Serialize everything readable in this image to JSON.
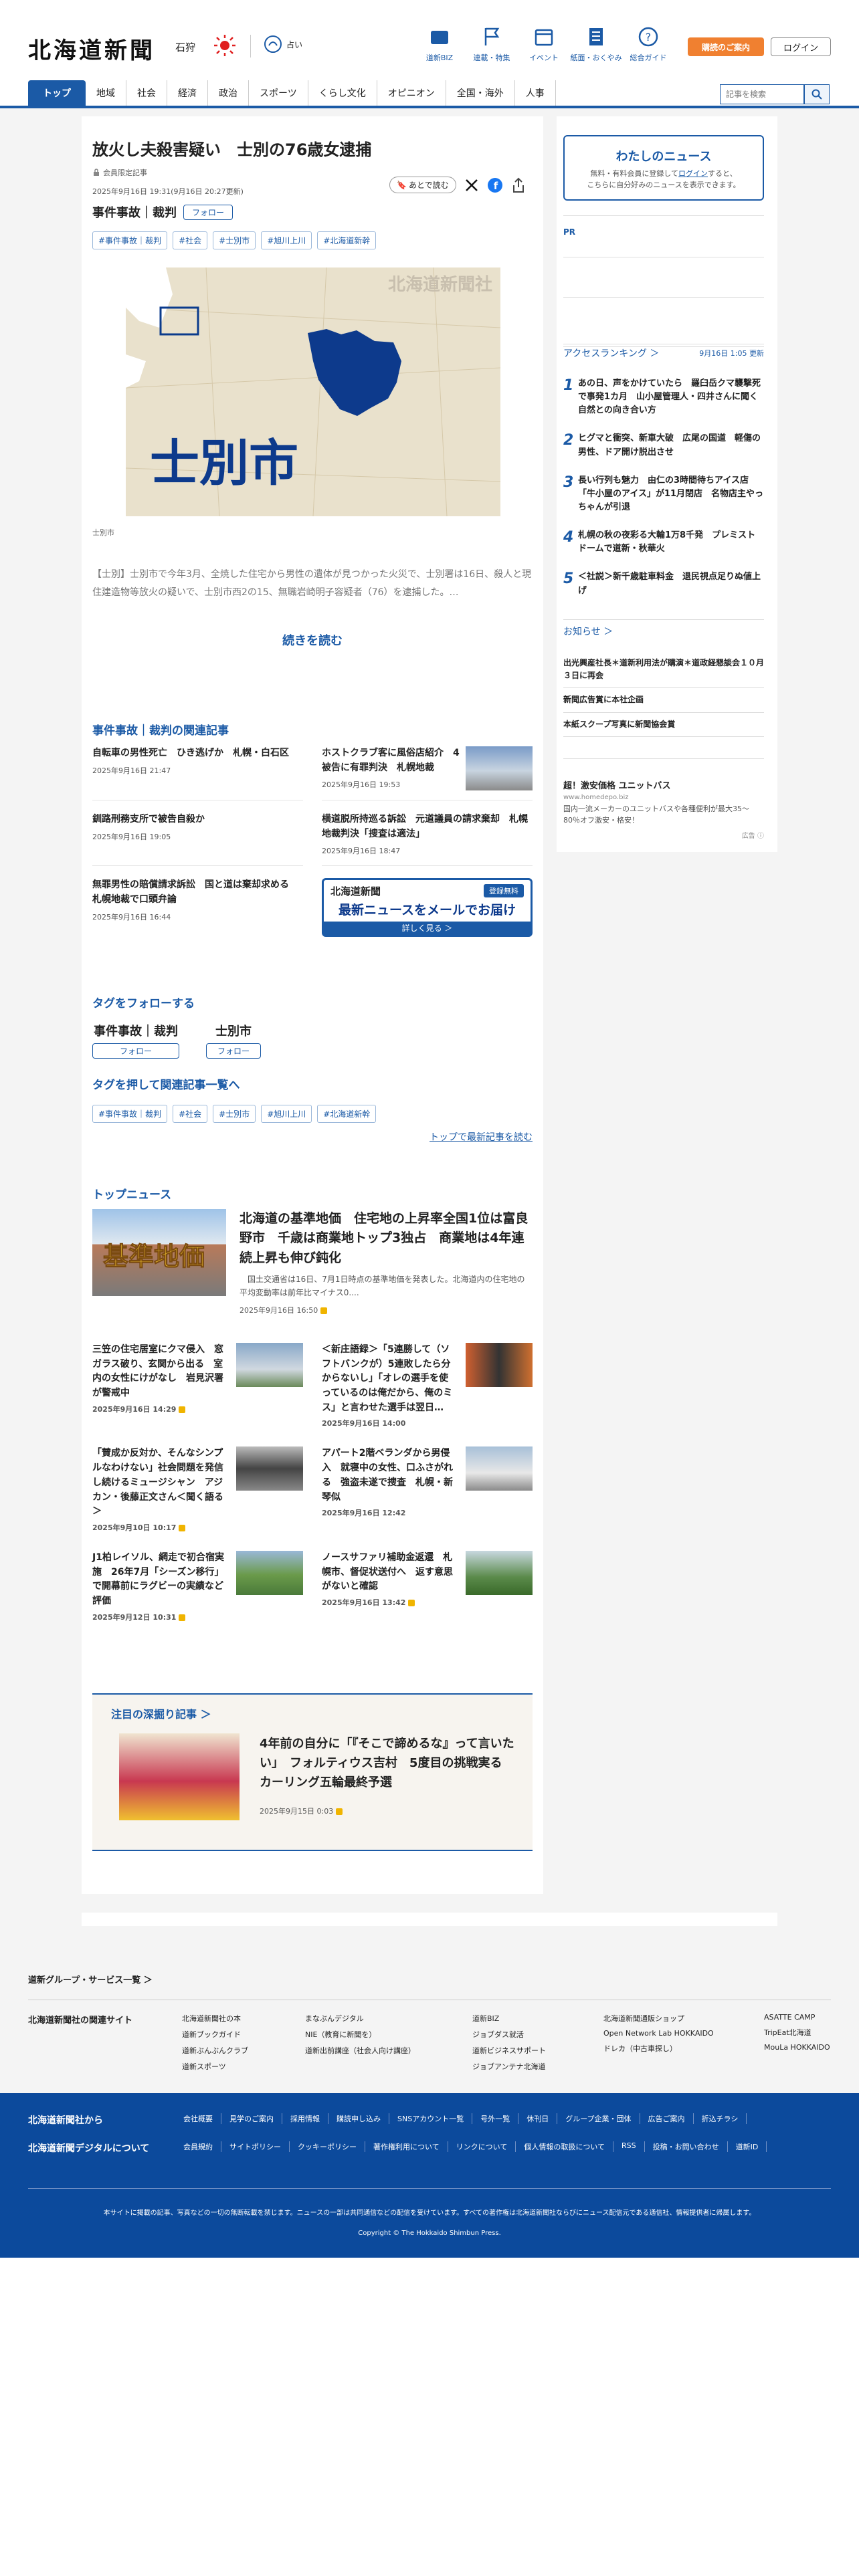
{
  "header": {
    "logo": "北海道新聞",
    "region": "石狩",
    "weather_label": "占い",
    "nav": [
      {
        "label": "道新BIZ"
      },
      {
        "label": "連載・特集"
      },
      {
        "label": "イベント"
      },
      {
        "label": "紙面・おくやみ"
      },
      {
        "label": "総合ガイド"
      }
    ],
    "subscribe": "購読のご案内",
    "login": "ログイン"
  },
  "catnav": {
    "tabs": [
      "トップ",
      "地域",
      "社会",
      "経済",
      "政治",
      "スポーツ",
      "くらし文化",
      "オピニオン",
      "全国・海外",
      "人事"
    ],
    "search_placeholder": "記事を検索"
  },
  "article": {
    "title": "放火し夫殺害疑い　士別の76歳女逮捕",
    "member": "会員限定記事",
    "updated": "2025年9月16日 19:31(9月16日 20:27更新)",
    "category": "事件事故｜裁判",
    "follow": "フォロー",
    "later": "あとで読む",
    "tags": [
      "#事件事故｜裁判",
      "#社会",
      "#士別市",
      "#旭川上川",
      "#北海道新幹"
    ],
    "map_text": "士別市",
    "map_watermark": "北海道新聞社",
    "caption": "士別市",
    "lead": "【士別】士別市で今年3月、全焼した住宅から男性の遺体が見つかった火災で、士別署は16日、殺人と現住建造物等放火の疑いで、士別市西2の15、無職岩崎明子容疑者（76）を逮捕した。…",
    "read_more": "続きを読む"
  },
  "related": {
    "heading": "事件事故｜裁判の関連記事",
    "items": [
      {
        "title": "自転車の男性死亡　ひき逃げか　札幌・白石区",
        "date": "2025年9月16日 21:47"
      },
      {
        "title": "ホストクラブ客に風俗店紹介　4被告に有罪判決　札幌地裁",
        "date": "2025年9月16日 19:53"
      },
      {
        "title": "釧路刑務支所で被告自殺か",
        "date": "2025年9月16日 19:05"
      },
      {
        "title": "横道脱所持巡る訴訟　元道議員の請求棄却　札幌地裁判決「捜査は適法」",
        "date": "2025年9月16日 18:47"
      },
      {
        "title": "無罪男性の賠償請求訴訟　国と道は棄却求める　札幌地裁で口頭弁論",
        "date": "2025年9月16日 16:44"
      }
    ],
    "banner_logo": "北海道新聞",
    "banner_badge": "登録無料",
    "banner_main": "最新ニュースをメールでお届け",
    "banner_sub": "詳しく見る ＞"
  },
  "tag_follow": {
    "heading": "タグをフォローする",
    "items": [
      {
        "name": "事件事故｜裁判",
        "btn": "フォロー"
      },
      {
        "name": "士別市",
        "btn": "フォロー"
      }
    ]
  },
  "tag_push": {
    "heading": "タグを押して関連記事一覧へ",
    "tags": [
      "#事件事故｜裁判",
      "#社会",
      "#士別市",
      "#旭川上川",
      "#北海道新幹"
    ],
    "link": "トップで最新記事を読む"
  },
  "top_news": {
    "heading": "トップニュース",
    "lead": {
      "title": "北海道の基準地価　住宅地の上昇率全国1位は富良野市　千歳は商業地トップ3独占　商業地は4年連続上昇も伸び鈍化",
      "snippet": "国土交通省は16日、7月1日時点の基準地価を発表した。北海道内の住宅地の平均変動率は前年比マイナス0....",
      "date": "2025年9月16日 16:50",
      "img_text": "基準地価"
    },
    "items": [
      {
        "title": "三笠の住宅居室にクマ侵入　窓ガラス破り、玄関から出る　室内の女性にけがなし　岩見沢署が警戒中",
        "date": "2025年9月16日 14:29"
      },
      {
        "title": "＜新庄語録＞「5連勝して（ソフトバンクが）5連敗したら分からないし」「オレの選手を使っているのは俺だから、俺のミス」と言わせた選手は翌日…",
        "date": "2025年9月16日 14:00"
      },
      {
        "title": "「賛成か反対か、そんなシンプルなわけない」社会問題を発信し続けるミュージシャン　アジカン・後藤正文さん＜聞く語る＞",
        "date": "2025年9月10日 10:17"
      },
      {
        "title": "アパート2階ベランダから男侵入　就寝中の女性、口ふさがれる　強盗未遂で捜査　札幌・新琴似",
        "date": "2025年9月16日 12:42"
      },
      {
        "title": "J1柏レイソル、網走で初合宿実施　26年7月「シーズン移行」で開幕前にラグビーの実績など評価",
        "date": "2025年9月12日 10:31"
      },
      {
        "title": "ノースサファリ補助金返還　札幌市、督促状送付へ　返す意思がないと確認",
        "date": "2025年9月16日 13:42"
      }
    ]
  },
  "deep": {
    "heading": "注目の深掘り記事",
    "title": "4年前の自分に「『そこで諦めるな』って言いたい」　フォルティウス吉村　5度目の挑戦実る　カーリング五輪最終予選",
    "date": "2025年9月15日 0:03"
  },
  "sidebar": {
    "mynews_title": "わたしのニュース",
    "mynews_text1": "無料・有料会員に登録して",
    "mynews_link": "ログイン",
    "mynews_text2": "すると、",
    "mynews_text3": "こちらに自分好みのニュースを表示できます。",
    "pr": "PR",
    "ranking_h": "アクセスランキング",
    "ranking_time": "9月16日 1:05 更新",
    "ranking": [
      {
        "n": "1",
        "t": "あの日、声をかけていたら　羅臼岳クマ襲撃死で事発1カ月　山小屋管理人・四井さんに聞く自然との向き合い方"
      },
      {
        "n": "2",
        "t": "ヒグマと衝突、新車大破　広尾の国道　軽傷の男性、ドア開け脱出させ"
      },
      {
        "n": "3",
        "t": "長い行列も魅力　由仁の3時間待ちアイス店「牛小屋のアイス」が11月閉店　名物店主やっちゃんが引退"
      },
      {
        "n": "4",
        "t": "札幌の秋の夜彩る大輪1万8千発　プレミストドームで道新・秋華火"
      },
      {
        "n": "5",
        "t": "＜社説＞新千歳駐車料金　退民視点足りぬ値上げ"
      }
    ],
    "notice_h": "お知らせ",
    "notices": [
      "出光興産社長＊道新利用法が購演＊道政経懇談会１０月３日に再会",
      "新聞広告賞に本社企画",
      "本紙スクープ写真に新聞協会賞"
    ],
    "ad_title": "超！激安価格 ユニットバス",
    "ad_url": "www.homedepo.biz",
    "ad_text": "国内一流メーカーのユニットバスや各種便利が最大35〜80％オフ激安・格安！",
    "ad_label": "広告"
  },
  "footer": {
    "grp_link": "道新グループ・サービス一覧",
    "related_h": "北海道新聞社の関連サイト",
    "related": [
      [
        "北海道新聞社の本",
        "道新ブックガイド",
        "道新ぶんぶんクラブ",
        "道新スポーツ"
      ],
      [
        "まなぶんデジタル",
        "NIE（教育に新聞を）",
        "道新出前講座（社会人向け講座）"
      ],
      [
        "道新BIZ",
        "ジョブダス就活",
        "道新ビジネスサポート",
        "ジョブアンテナ北海道"
      ],
      [
        "北海道新聞通販ショップ",
        "Open Network Lab HOKKAIDO",
        "ドレカ（中古車探し）"
      ],
      [
        "ASATTE CAMP",
        "TripEat北海道",
        "MouLa HOKKAIDO"
      ]
    ],
    "blue_h1": "北海道新聞社から",
    "blue_h2": "北海道新聞デジタルについて",
    "links1": [
      "会社概要",
      "見学のご案内",
      "採用情報",
      "購読申し込み",
      "SNSアカウント一覧",
      "号外一覧",
      "休刊日",
      "グループ企業・団体",
      "広告ご案内",
      "折込チラシ"
    ],
    "links2": [
      "会員規約",
      "サイトポリシー",
      "クッキーポリシー",
      "著作権利用について",
      "リンクについて",
      "個人情報の取扱について",
      "RSS",
      "投稿・お問い合わせ",
      "道新ID"
    ],
    "notice": "本サイトに掲載の記事、写真などの一切の無断転載を禁じます。ニュースの一部は共同通信などの配信を受けています。すべての著作権は北海道新聞社ならびにニュース配信元である通信社、情報提供者に帰属します。",
    "copyright": "Copyright © The Hokkaido Shimbun Press."
  }
}
